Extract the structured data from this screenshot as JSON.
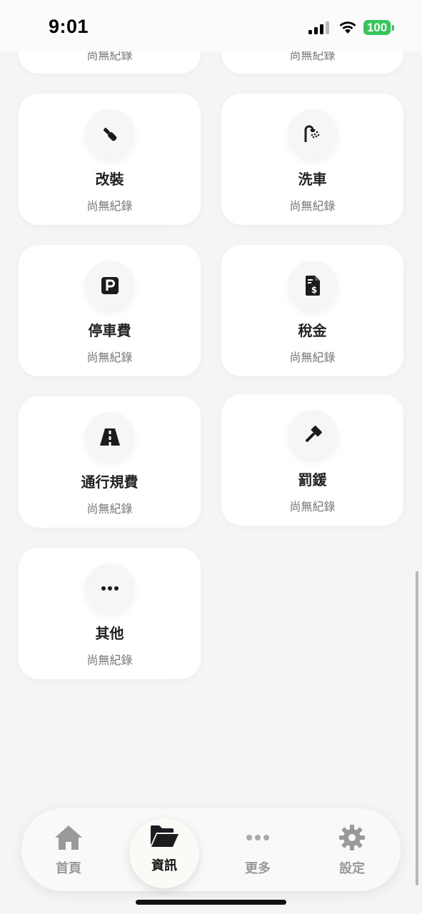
{
  "status_bar": {
    "time": "9:01",
    "battery": "100"
  },
  "partial_cards": [
    {
      "sub": "尚無紀錄"
    },
    {
      "sub": "尚無紀錄"
    }
  ],
  "cards": [
    {
      "title": "改裝",
      "sub": "尚無紀錄",
      "icon": "wrench-icon"
    },
    {
      "title": "洗車",
      "sub": "尚無紀錄",
      "icon": "shower-icon"
    },
    {
      "title": "停車費",
      "sub": "尚無紀錄",
      "icon": "parking-icon"
    },
    {
      "title": "稅金",
      "sub": "尚無紀錄",
      "icon": "tax-document-icon"
    },
    {
      "title": "通行規費",
      "sub": "尚無紀錄",
      "icon": "road-icon"
    },
    {
      "title": "罰鍰",
      "sub": "尚無紀錄",
      "icon": "gavel-icon"
    },
    {
      "title": "其他",
      "sub": "尚無紀錄",
      "icon": "more-icon"
    }
  ],
  "tabbar": {
    "home": "首頁",
    "info": "資訊",
    "more": "更多",
    "settings": "設定",
    "active": "info"
  },
  "colors": {
    "battery": "#34c759",
    "icon": "#1c1c1e",
    "inactive_tab": "#999999"
  }
}
